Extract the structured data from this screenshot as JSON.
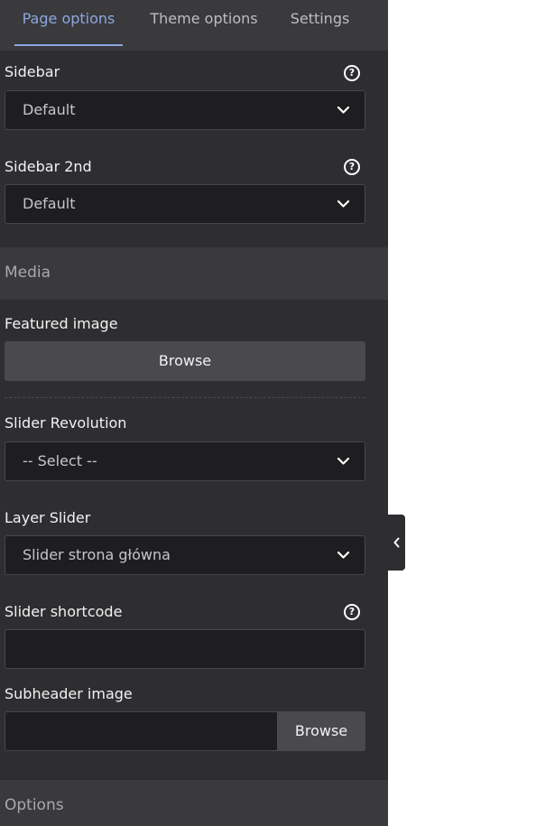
{
  "tabs": [
    {
      "label": "Page options",
      "active": true
    },
    {
      "label": "Theme options",
      "active": false
    },
    {
      "label": "Settings",
      "active": false
    }
  ],
  "fields": {
    "sidebar": {
      "label": "Sidebar",
      "value": "Default"
    },
    "sidebar2": {
      "label": "Sidebar 2nd",
      "value": "Default"
    },
    "featured_image": {
      "label": "Featured image",
      "button": "Browse"
    },
    "slider_revolution": {
      "label": "Slider Revolution",
      "value": "-- Select --"
    },
    "layer_slider": {
      "label": "Layer Slider",
      "value": "Slider strona główna"
    },
    "slider_shortcode": {
      "label": "Slider shortcode",
      "value": ""
    },
    "subheader_image": {
      "label": "Subheader image",
      "value": "",
      "button": "Browse"
    }
  },
  "sections": {
    "media": "Media",
    "options": "Options"
  },
  "icons": {
    "help": "question-circle-icon",
    "dropdown": "chevron-down-icon",
    "collapse": "chevron-left-icon"
  },
  "colors": {
    "accent": "#8ca6e0",
    "panel": "#2e2e31",
    "field": "#1e1e20"
  }
}
